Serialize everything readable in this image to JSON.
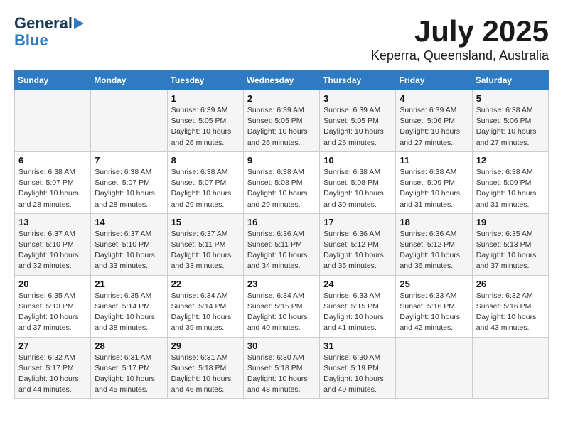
{
  "header": {
    "logo_line1": "General",
    "logo_line2": "Blue",
    "title": "July 2025",
    "subtitle": "Keperra, Queensland, Australia"
  },
  "days_of_week": [
    "Sunday",
    "Monday",
    "Tuesday",
    "Wednesday",
    "Thursday",
    "Friday",
    "Saturday"
  ],
  "weeks": [
    [
      {
        "day": "",
        "info": ""
      },
      {
        "day": "",
        "info": ""
      },
      {
        "day": "1",
        "info": "Sunrise: 6:39 AM\nSunset: 5:05 PM\nDaylight: 10 hours and 26 minutes."
      },
      {
        "day": "2",
        "info": "Sunrise: 6:39 AM\nSunset: 5:05 PM\nDaylight: 10 hours and 26 minutes."
      },
      {
        "day": "3",
        "info": "Sunrise: 6:39 AM\nSunset: 5:05 PM\nDaylight: 10 hours and 26 minutes."
      },
      {
        "day": "4",
        "info": "Sunrise: 6:39 AM\nSunset: 5:06 PM\nDaylight: 10 hours and 27 minutes."
      },
      {
        "day": "5",
        "info": "Sunrise: 6:38 AM\nSunset: 5:06 PM\nDaylight: 10 hours and 27 minutes."
      }
    ],
    [
      {
        "day": "6",
        "info": "Sunrise: 6:38 AM\nSunset: 5:07 PM\nDaylight: 10 hours and 28 minutes."
      },
      {
        "day": "7",
        "info": "Sunrise: 6:38 AM\nSunset: 5:07 PM\nDaylight: 10 hours and 28 minutes."
      },
      {
        "day": "8",
        "info": "Sunrise: 6:38 AM\nSunset: 5:07 PM\nDaylight: 10 hours and 29 minutes."
      },
      {
        "day": "9",
        "info": "Sunrise: 6:38 AM\nSunset: 5:08 PM\nDaylight: 10 hours and 29 minutes."
      },
      {
        "day": "10",
        "info": "Sunrise: 6:38 AM\nSunset: 5:08 PM\nDaylight: 10 hours and 30 minutes."
      },
      {
        "day": "11",
        "info": "Sunrise: 6:38 AM\nSunset: 5:09 PM\nDaylight: 10 hours and 31 minutes."
      },
      {
        "day": "12",
        "info": "Sunrise: 6:38 AM\nSunset: 5:09 PM\nDaylight: 10 hours and 31 minutes."
      }
    ],
    [
      {
        "day": "13",
        "info": "Sunrise: 6:37 AM\nSunset: 5:10 PM\nDaylight: 10 hours and 32 minutes."
      },
      {
        "day": "14",
        "info": "Sunrise: 6:37 AM\nSunset: 5:10 PM\nDaylight: 10 hours and 33 minutes."
      },
      {
        "day": "15",
        "info": "Sunrise: 6:37 AM\nSunset: 5:11 PM\nDaylight: 10 hours and 33 minutes."
      },
      {
        "day": "16",
        "info": "Sunrise: 6:36 AM\nSunset: 5:11 PM\nDaylight: 10 hours and 34 minutes."
      },
      {
        "day": "17",
        "info": "Sunrise: 6:36 AM\nSunset: 5:12 PM\nDaylight: 10 hours and 35 minutes."
      },
      {
        "day": "18",
        "info": "Sunrise: 6:36 AM\nSunset: 5:12 PM\nDaylight: 10 hours and 36 minutes."
      },
      {
        "day": "19",
        "info": "Sunrise: 6:35 AM\nSunset: 5:13 PM\nDaylight: 10 hours and 37 minutes."
      }
    ],
    [
      {
        "day": "20",
        "info": "Sunrise: 6:35 AM\nSunset: 5:13 PM\nDaylight: 10 hours and 37 minutes."
      },
      {
        "day": "21",
        "info": "Sunrise: 6:35 AM\nSunset: 5:14 PM\nDaylight: 10 hours and 38 minutes."
      },
      {
        "day": "22",
        "info": "Sunrise: 6:34 AM\nSunset: 5:14 PM\nDaylight: 10 hours and 39 minutes."
      },
      {
        "day": "23",
        "info": "Sunrise: 6:34 AM\nSunset: 5:15 PM\nDaylight: 10 hours and 40 minutes."
      },
      {
        "day": "24",
        "info": "Sunrise: 6:33 AM\nSunset: 5:15 PM\nDaylight: 10 hours and 41 minutes."
      },
      {
        "day": "25",
        "info": "Sunrise: 6:33 AM\nSunset: 5:16 PM\nDaylight: 10 hours and 42 minutes."
      },
      {
        "day": "26",
        "info": "Sunrise: 6:32 AM\nSunset: 5:16 PM\nDaylight: 10 hours and 43 minutes."
      }
    ],
    [
      {
        "day": "27",
        "info": "Sunrise: 6:32 AM\nSunset: 5:17 PM\nDaylight: 10 hours and 44 minutes."
      },
      {
        "day": "28",
        "info": "Sunrise: 6:31 AM\nSunset: 5:17 PM\nDaylight: 10 hours and 45 minutes."
      },
      {
        "day": "29",
        "info": "Sunrise: 6:31 AM\nSunset: 5:18 PM\nDaylight: 10 hours and 46 minutes."
      },
      {
        "day": "30",
        "info": "Sunrise: 6:30 AM\nSunset: 5:18 PM\nDaylight: 10 hours and 48 minutes."
      },
      {
        "day": "31",
        "info": "Sunrise: 6:30 AM\nSunset: 5:19 PM\nDaylight: 10 hours and 49 minutes."
      },
      {
        "day": "",
        "info": ""
      },
      {
        "day": "",
        "info": ""
      }
    ]
  ]
}
